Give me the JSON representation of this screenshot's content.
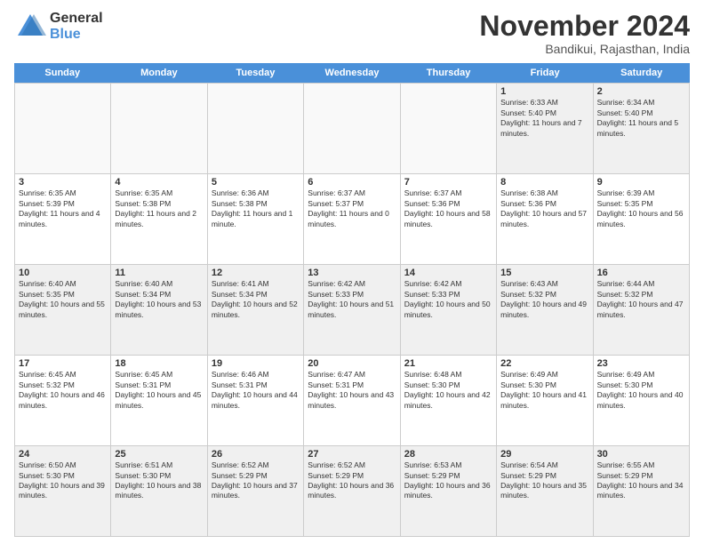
{
  "logo": {
    "general": "General",
    "blue": "Blue"
  },
  "title": "November 2024",
  "subtitle": "Bandikui, Rajasthan, India",
  "weekdays": [
    "Sunday",
    "Monday",
    "Tuesday",
    "Wednesday",
    "Thursday",
    "Friday",
    "Saturday"
  ],
  "weeks": [
    [
      {
        "day": "",
        "info": "",
        "empty": true
      },
      {
        "day": "",
        "info": "",
        "empty": true
      },
      {
        "day": "",
        "info": "",
        "empty": true
      },
      {
        "day": "",
        "info": "",
        "empty": true
      },
      {
        "day": "",
        "info": "",
        "empty": true
      },
      {
        "day": "1",
        "info": "Sunrise: 6:33 AM\nSunset: 5:40 PM\nDaylight: 11 hours and 7 minutes.",
        "empty": false
      },
      {
        "day": "2",
        "info": "Sunrise: 6:34 AM\nSunset: 5:40 PM\nDaylight: 11 hours and 5 minutes.",
        "empty": false
      }
    ],
    [
      {
        "day": "3",
        "info": "Sunrise: 6:35 AM\nSunset: 5:39 PM\nDaylight: 11 hours and 4 minutes.",
        "empty": false
      },
      {
        "day": "4",
        "info": "Sunrise: 6:35 AM\nSunset: 5:38 PM\nDaylight: 11 hours and 2 minutes.",
        "empty": false
      },
      {
        "day": "5",
        "info": "Sunrise: 6:36 AM\nSunset: 5:38 PM\nDaylight: 11 hours and 1 minute.",
        "empty": false
      },
      {
        "day": "6",
        "info": "Sunrise: 6:37 AM\nSunset: 5:37 PM\nDaylight: 11 hours and 0 minutes.",
        "empty": false
      },
      {
        "day": "7",
        "info": "Sunrise: 6:37 AM\nSunset: 5:36 PM\nDaylight: 10 hours and 58 minutes.",
        "empty": false
      },
      {
        "day": "8",
        "info": "Sunrise: 6:38 AM\nSunset: 5:36 PM\nDaylight: 10 hours and 57 minutes.",
        "empty": false
      },
      {
        "day": "9",
        "info": "Sunrise: 6:39 AM\nSunset: 5:35 PM\nDaylight: 10 hours and 56 minutes.",
        "empty": false
      }
    ],
    [
      {
        "day": "10",
        "info": "Sunrise: 6:40 AM\nSunset: 5:35 PM\nDaylight: 10 hours and 55 minutes.",
        "empty": false
      },
      {
        "day": "11",
        "info": "Sunrise: 6:40 AM\nSunset: 5:34 PM\nDaylight: 10 hours and 53 minutes.",
        "empty": false
      },
      {
        "day": "12",
        "info": "Sunrise: 6:41 AM\nSunset: 5:34 PM\nDaylight: 10 hours and 52 minutes.",
        "empty": false
      },
      {
        "day": "13",
        "info": "Sunrise: 6:42 AM\nSunset: 5:33 PM\nDaylight: 10 hours and 51 minutes.",
        "empty": false
      },
      {
        "day": "14",
        "info": "Sunrise: 6:42 AM\nSunset: 5:33 PM\nDaylight: 10 hours and 50 minutes.",
        "empty": false
      },
      {
        "day": "15",
        "info": "Sunrise: 6:43 AM\nSunset: 5:32 PM\nDaylight: 10 hours and 49 minutes.",
        "empty": false
      },
      {
        "day": "16",
        "info": "Sunrise: 6:44 AM\nSunset: 5:32 PM\nDaylight: 10 hours and 47 minutes.",
        "empty": false
      }
    ],
    [
      {
        "day": "17",
        "info": "Sunrise: 6:45 AM\nSunset: 5:32 PM\nDaylight: 10 hours and 46 minutes.",
        "empty": false
      },
      {
        "day": "18",
        "info": "Sunrise: 6:45 AM\nSunset: 5:31 PM\nDaylight: 10 hours and 45 minutes.",
        "empty": false
      },
      {
        "day": "19",
        "info": "Sunrise: 6:46 AM\nSunset: 5:31 PM\nDaylight: 10 hours and 44 minutes.",
        "empty": false
      },
      {
        "day": "20",
        "info": "Sunrise: 6:47 AM\nSunset: 5:31 PM\nDaylight: 10 hours and 43 minutes.",
        "empty": false
      },
      {
        "day": "21",
        "info": "Sunrise: 6:48 AM\nSunset: 5:30 PM\nDaylight: 10 hours and 42 minutes.",
        "empty": false
      },
      {
        "day": "22",
        "info": "Sunrise: 6:49 AM\nSunset: 5:30 PM\nDaylight: 10 hours and 41 minutes.",
        "empty": false
      },
      {
        "day": "23",
        "info": "Sunrise: 6:49 AM\nSunset: 5:30 PM\nDaylight: 10 hours and 40 minutes.",
        "empty": false
      }
    ],
    [
      {
        "day": "24",
        "info": "Sunrise: 6:50 AM\nSunset: 5:30 PM\nDaylight: 10 hours and 39 minutes.",
        "empty": false
      },
      {
        "day": "25",
        "info": "Sunrise: 6:51 AM\nSunset: 5:30 PM\nDaylight: 10 hours and 38 minutes.",
        "empty": false
      },
      {
        "day": "26",
        "info": "Sunrise: 6:52 AM\nSunset: 5:29 PM\nDaylight: 10 hours and 37 minutes.",
        "empty": false
      },
      {
        "day": "27",
        "info": "Sunrise: 6:52 AM\nSunset: 5:29 PM\nDaylight: 10 hours and 36 minutes.",
        "empty": false
      },
      {
        "day": "28",
        "info": "Sunrise: 6:53 AM\nSunset: 5:29 PM\nDaylight: 10 hours and 36 minutes.",
        "empty": false
      },
      {
        "day": "29",
        "info": "Sunrise: 6:54 AM\nSunset: 5:29 PM\nDaylight: 10 hours and 35 minutes.",
        "empty": false
      },
      {
        "day": "30",
        "info": "Sunrise: 6:55 AM\nSunset: 5:29 PM\nDaylight: 10 hours and 34 minutes.",
        "empty": false
      }
    ]
  ]
}
